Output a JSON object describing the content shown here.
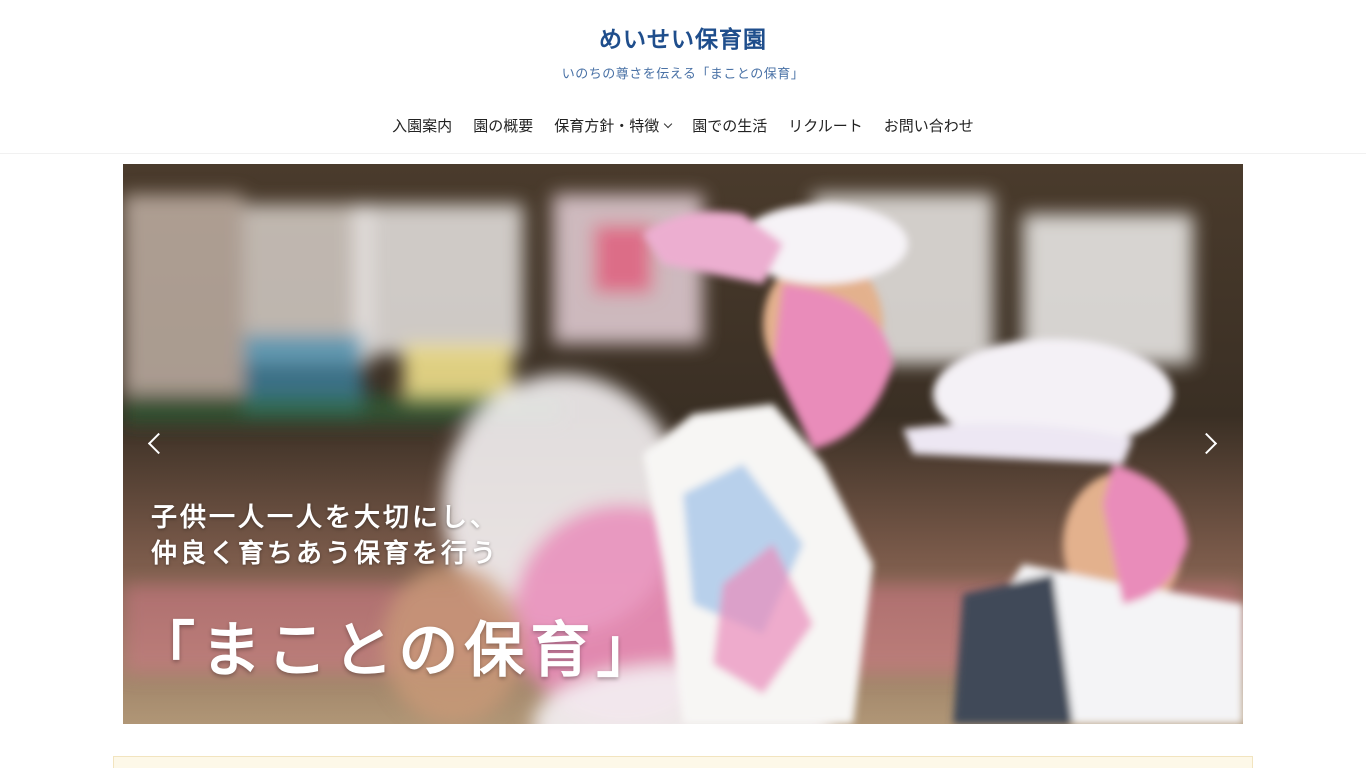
{
  "site": {
    "title": "めいせい保育園",
    "tagline": "いのちの尊さを伝える「まことの保育」"
  },
  "nav": {
    "items": [
      {
        "label": "入園案内"
      },
      {
        "label": "園の概要"
      },
      {
        "label": "保育方針・特徴"
      },
      {
        "label": "園での生活"
      },
      {
        "label": "リクルート"
      },
      {
        "label": "お問い合わせ"
      }
    ]
  },
  "hero": {
    "caption_line1": "子供一人一人を大切にし、",
    "caption_line2": "仲良く育ちあう保育を行う",
    "caption_main": "「まことの保育」",
    "colors": {
      "cap_white": "#f4f1f6",
      "cap_pink": "#e98cba",
      "ground": "#a78e70"
    }
  },
  "colors": {
    "title": "#1f4e8c",
    "tagline": "#4a72a6",
    "notice_bg": "#fdf8e8"
  }
}
